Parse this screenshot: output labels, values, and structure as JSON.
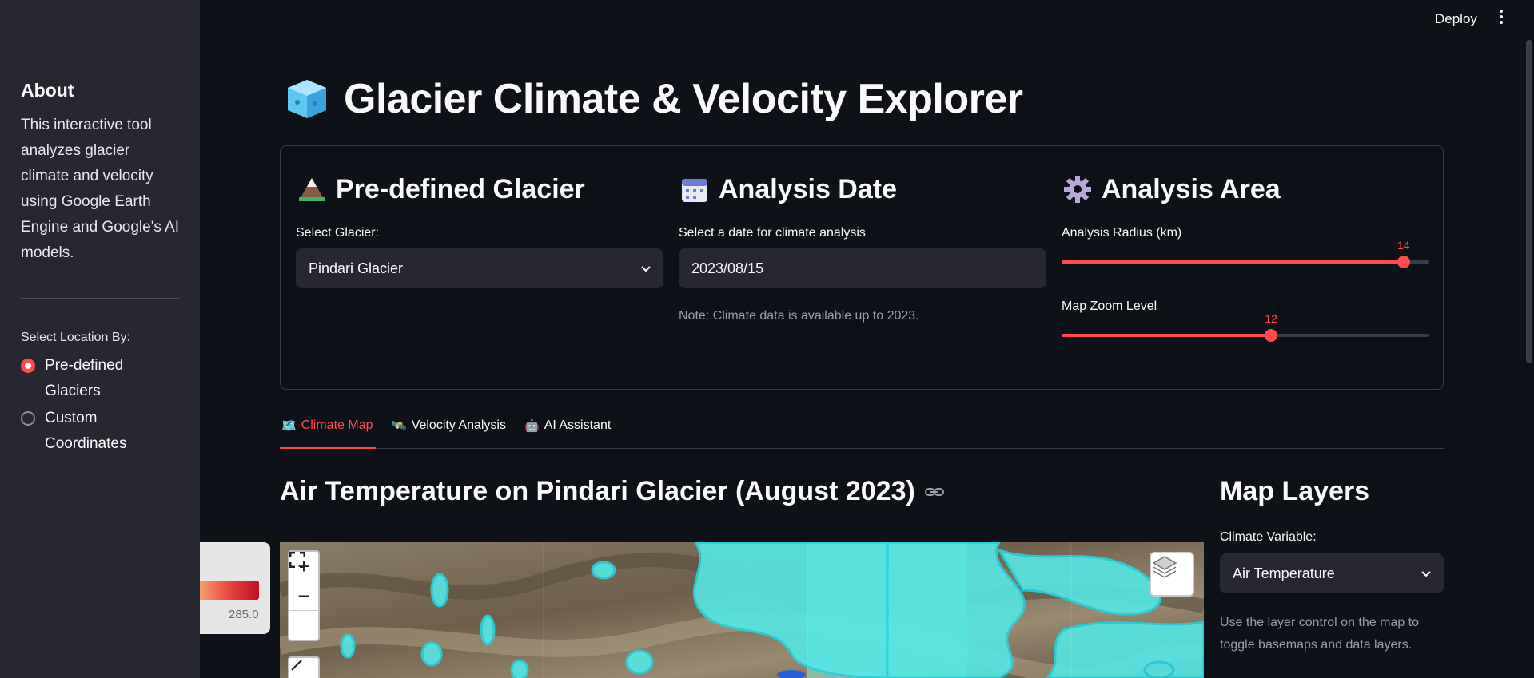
{
  "sidebar": {
    "about_title": "About",
    "about_text": "This interactive tool analyzes glacier climate and velocity using Google Earth Engine and Google's AI models.",
    "location_label": "Select Location By:",
    "options": [
      {
        "label": "Pre-defined Glaciers",
        "selected": true
      },
      {
        "label": "Custom Coordinates",
        "selected": false
      }
    ]
  },
  "topbar": {
    "deploy_label": "Deploy",
    "menu_icon": "kebab-menu-icon"
  },
  "header": {
    "title": "Glacier Climate & Velocity Explorer",
    "icon": "ice-cube-icon"
  },
  "controls": {
    "glacier": {
      "heading": "Pre-defined Glacier",
      "icon": "mountain-icon",
      "label": "Select Glacier:",
      "value": "Pindari Glacier"
    },
    "date": {
      "heading": "Analysis Date",
      "icon": "calendar-icon",
      "label": "Select a date for climate analysis",
      "value": "2023/08/15",
      "note": "Note: Climate data is available up to 2023."
    },
    "area": {
      "heading": "Analysis Area",
      "icon": "gear-icon",
      "radius_label": "Analysis Radius (km)",
      "radius_value": "14",
      "radius_fraction": 0.93,
      "zoom_label": "Map Zoom Level",
      "zoom_value": "12",
      "zoom_fraction": 0.57
    }
  },
  "tabs": [
    {
      "label": "Climate Map",
      "icon": "🗺️",
      "active": true
    },
    {
      "label": "Velocity Analysis",
      "icon": "🛰️",
      "active": false
    },
    {
      "label": "AI Assistant",
      "icon": "🤖",
      "active": false
    }
  ],
  "content": {
    "section_title": "Air Temperature on Pindari Glacier (August 2023)",
    "legend_max": "285.0"
  },
  "map_layers": {
    "title": "Map Layers",
    "variable_label": "Climate Variable:",
    "variable_value": "Air Temperature",
    "note": "Use the layer control on the map to toggle basemaps and data layers."
  },
  "colors": {
    "accent": "#ff4b4b",
    "background": "#0e1117",
    "sidebar": "#262730",
    "glacier": "#2ee6e6"
  }
}
